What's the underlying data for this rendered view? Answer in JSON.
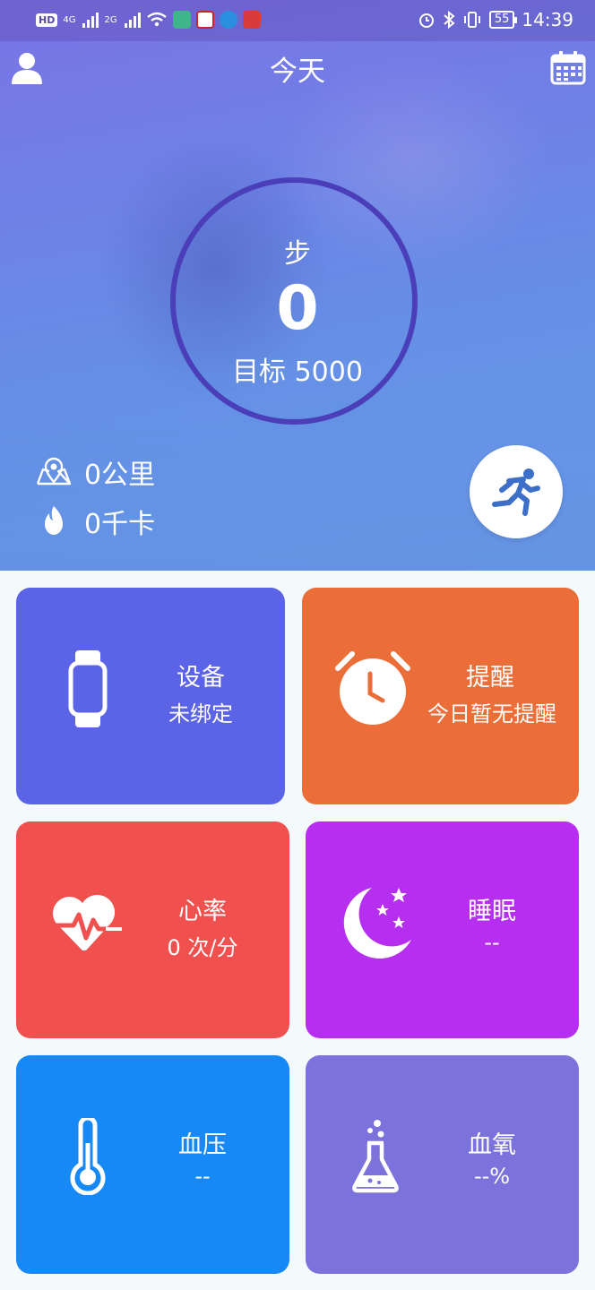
{
  "status_bar": {
    "hd": "HD",
    "sim1_type": "4G",
    "sim2_type": "2G",
    "battery": "55",
    "time": "14:39"
  },
  "header": {
    "title": "今天"
  },
  "steps": {
    "label": "步",
    "value": "0",
    "goal": "目标 5000"
  },
  "stats": {
    "distance": "0公里",
    "calories": "0千卡"
  },
  "cards": {
    "device": {
      "title": "设备",
      "subtitle": "未绑定",
      "color": "#5b63e6"
    },
    "reminder": {
      "title": "提醒",
      "subtitle": "今日暂无提醒",
      "color": "#eb6d38"
    },
    "heart": {
      "title": "心率",
      "subtitle": "0 次/分",
      "color": "#f0504e"
    },
    "sleep": {
      "title": "睡眠",
      "subtitle": "--",
      "color": "#b62ef0"
    },
    "blood_pressure": {
      "title": "血压",
      "subtitle": "--",
      "color": "#1789f6"
    },
    "blood_oxygen": {
      "title": "血氧",
      "subtitle": "--%",
      "color": "#7b72dc"
    }
  },
  "icons": [
    "user-icon",
    "calendar-icon",
    "map-pin-icon",
    "flame-icon",
    "running-icon",
    "watch-icon",
    "alarm-clock-icon",
    "heart-pulse-icon",
    "moon-stars-icon",
    "thermometer-icon",
    "flask-icon"
  ]
}
